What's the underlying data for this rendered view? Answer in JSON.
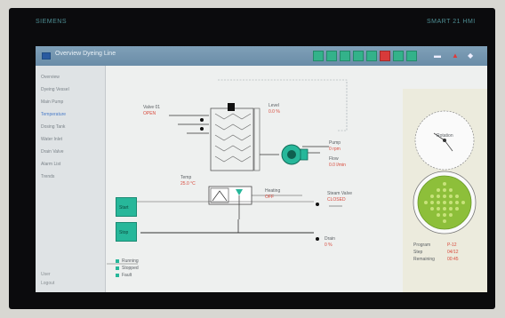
{
  "monitor": {
    "brand_left": "SIEMENS",
    "brand_right": "SMART 21 HMI"
  },
  "app": {
    "title": "Overview Dyeing Line"
  },
  "toolbar": {
    "buttons": [
      {
        "name": "tb-1",
        "color": "green"
      },
      {
        "name": "tb-2",
        "color": "green"
      },
      {
        "name": "tb-3",
        "color": "green"
      },
      {
        "name": "tb-4",
        "color": "green"
      },
      {
        "name": "tb-5",
        "color": "green"
      },
      {
        "name": "tb-6",
        "color": "red"
      },
      {
        "name": "tb-7",
        "color": "green"
      },
      {
        "name": "tb-8",
        "color": "green"
      }
    ]
  },
  "sidebar": {
    "items": [
      "Overview",
      "Dyeing Vessel",
      "Main Pump",
      "Temperature",
      "Dosing Tank",
      "Water Inlet",
      "Drain Valve",
      "Alarm List",
      "Trends"
    ],
    "active_index": 3,
    "footer": [
      "User",
      "Logout"
    ]
  },
  "process": {
    "labels": [
      {
        "text": "Valve 01",
        "red": "OPEN"
      },
      {
        "text": "Level",
        "red": "0.0 %"
      },
      {
        "text": "Pump",
        "red": "0 rpm"
      },
      {
        "text": "Flow",
        "red": "0.0 l/min"
      },
      {
        "text": "Temp",
        "red": "25.0 °C"
      },
      {
        "text": "Heating",
        "red": "OFF"
      },
      {
        "text": "Steam Valve",
        "red": "CLOSED"
      },
      {
        "text": "Drain",
        "red": "0 %"
      }
    ],
    "buttons": [
      "Start",
      "Stop"
    ],
    "legend": [
      "Running",
      "Stopped",
      "Fault"
    ]
  },
  "right_panel": {
    "gauge_label": "Rotation",
    "status": [
      {
        "text": "Program",
        "red": "P-12"
      },
      {
        "text": "Step",
        "red": "04/12"
      },
      {
        "text": "Remaining",
        "red": "00:45"
      }
    ]
  },
  "colors": {
    "accent": "#27b79a",
    "alarm": "#d83a3a",
    "title_bar": "#6f91ab"
  }
}
